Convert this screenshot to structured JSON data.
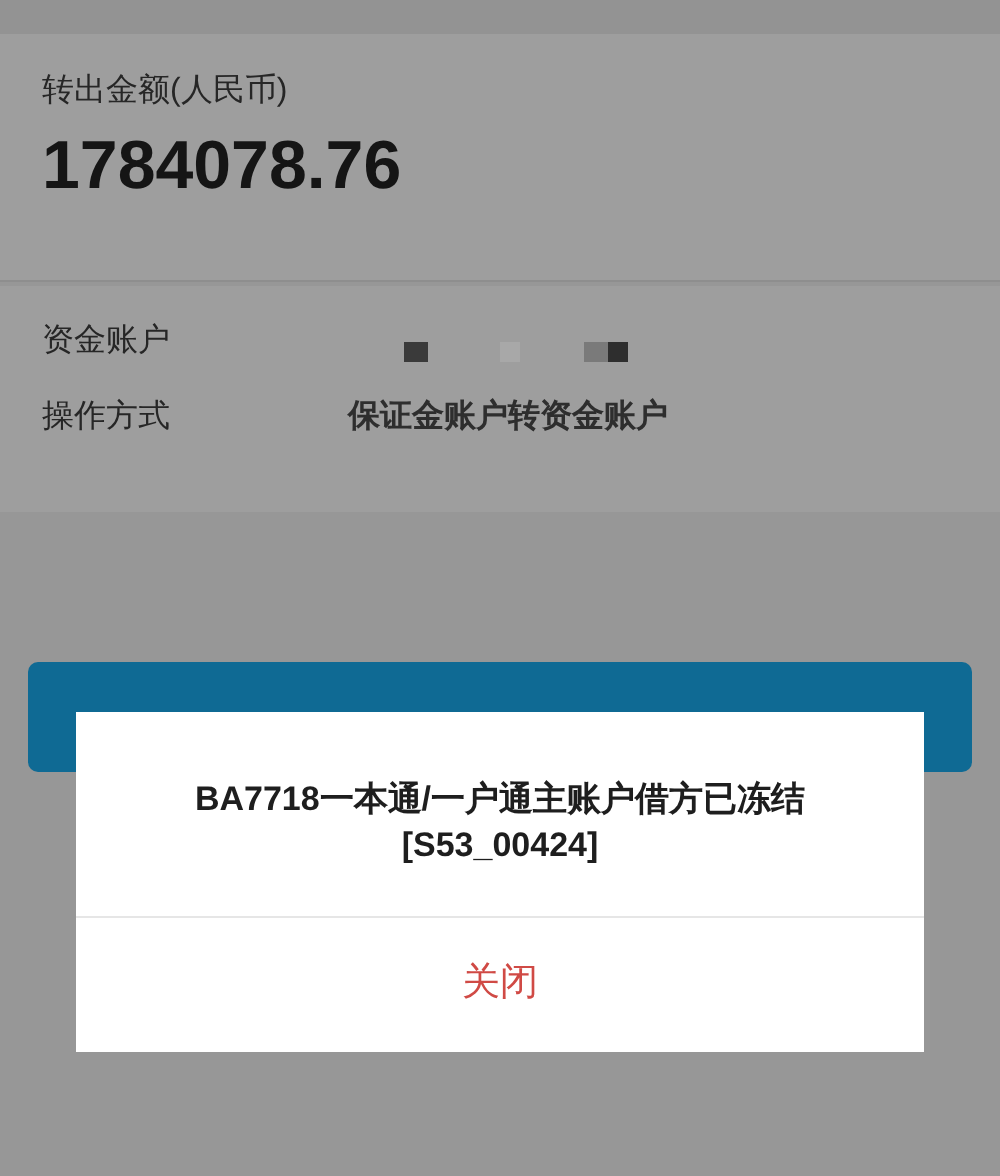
{
  "transfer": {
    "label": "转出金额(人民币)",
    "amount": "1784078.76"
  },
  "details": [
    {
      "label": "资金账户",
      "kind": "redacted"
    },
    {
      "label": "操作方式",
      "kind": "text",
      "value": "保证金账户转资金账户"
    }
  ],
  "dialog": {
    "message_lines": [
      "BA7718一本通/一户通主账户借方已冻结",
      "[S53_00424]"
    ],
    "close_button": "关闭"
  }
}
